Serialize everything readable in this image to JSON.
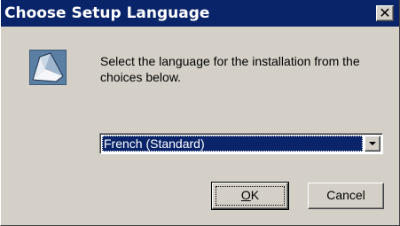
{
  "window": {
    "title": "Choose Setup Language",
    "close_glyph": "✕"
  },
  "message": "Select the language for the installation from the choices below.",
  "language_select": {
    "value": "French (Standard)"
  },
  "buttons": {
    "ok_mnemonic": "O",
    "ok_rest": "K",
    "cancel": "Cancel"
  },
  "colors": {
    "titlebar": "#0a246a",
    "face": "#d4d0c8",
    "selection": "#0a246a"
  },
  "icons": {
    "app": "setup-app-icon",
    "close": "close-icon",
    "dropdown": "chevron-down-icon"
  }
}
